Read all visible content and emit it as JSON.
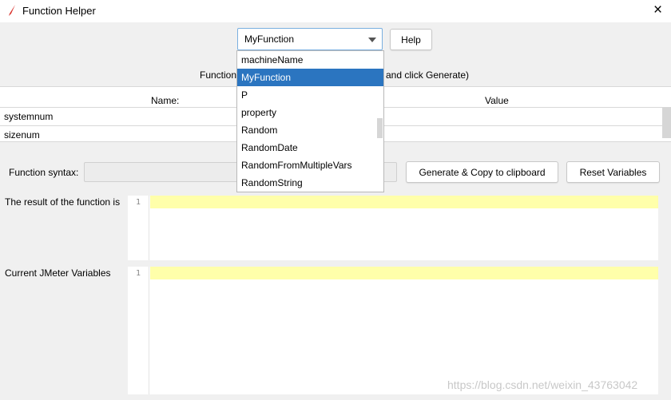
{
  "window": {
    "title": "Function Helper",
    "close_icon": "×"
  },
  "combo": {
    "selected": "MyFunction",
    "options": [
      "machineName",
      "MyFunction",
      "P",
      "property",
      "Random",
      "RandomDate",
      "RandomFromMultipleVars",
      "RandomString"
    ]
  },
  "help_label": "Help",
  "instruction": {
    "left": "Function",
    "right": "and click Generate)"
  },
  "table": {
    "headers": [
      "Name:",
      "Value"
    ],
    "rows": [
      {
        "name": "systemnum",
        "value": ""
      },
      {
        "name": "sizenum",
        "value": ""
      }
    ]
  },
  "syntax": {
    "label": "Function syntax:",
    "value": ""
  },
  "generate_label": "Generate & Copy to clipboard",
  "reset_label": "Reset Variables",
  "result": {
    "label": "The result of the function is",
    "line": "1"
  },
  "variables": {
    "label": "Current JMeter Variables",
    "line": "1"
  },
  "watermark": "https://blog.csdn.net/weixin_43763042"
}
